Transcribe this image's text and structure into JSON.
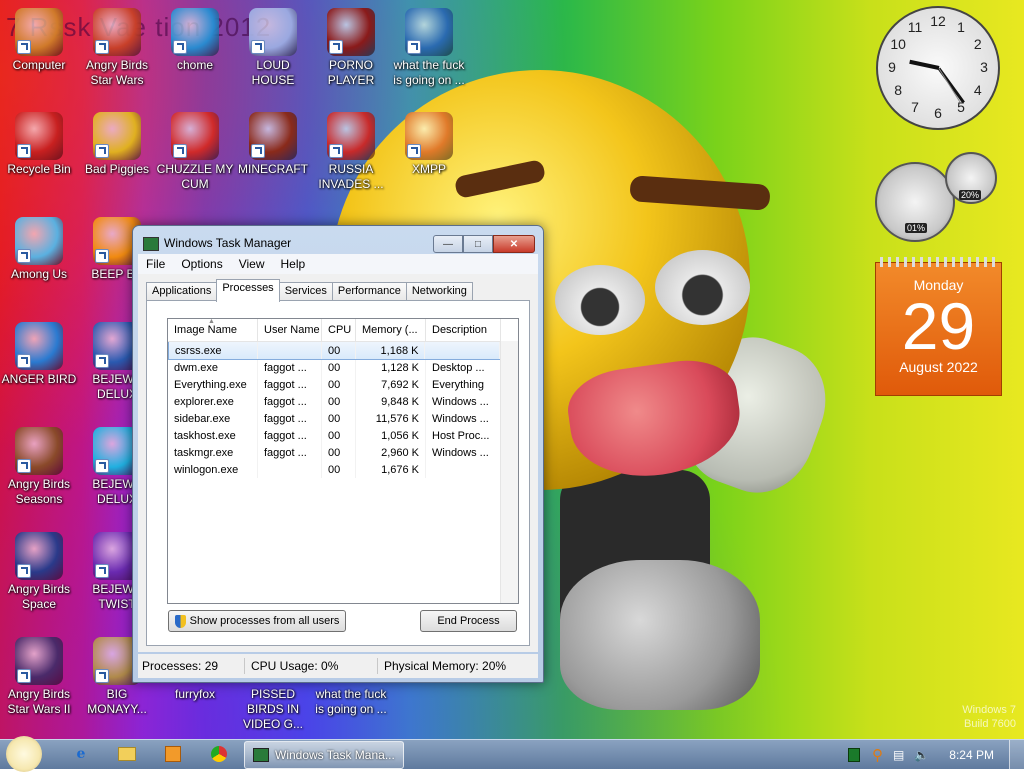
{
  "desktop": {
    "overlay_title": "7 Rssk Vae tion 2012",
    "icons": [
      {
        "label": "Computer",
        "icon": "computer-icon",
        "color": "#d07a2a"
      },
      {
        "label": "Angry Birds Star Wars",
        "icon": "angry-birds-star-wars-icon",
        "color": "#c8402a"
      },
      {
        "label": "chome",
        "icon": "chrome-icon",
        "color": "#2a8ad0"
      },
      {
        "label": "LOUD HOUSE",
        "icon": "loud-house-icon",
        "color": "#9aa8e0"
      },
      {
        "label": "PORNO PLAYER",
        "icon": "flash-player-icon",
        "color": "#8a1a1a"
      },
      {
        "label": "what the fuck is going on ...",
        "icon": "angry-birds-space-icon",
        "color": "#2a6ab0"
      },
      {
        "label": "Recycle Bin",
        "icon": "recycle-bin-icon",
        "color": "#c82020"
      },
      {
        "label": "Bad Piggies",
        "icon": "bad-piggies-icon",
        "color": "#e0b020"
      },
      {
        "label": "CHUZZLE MY CUM",
        "icon": "chuzzle-icon",
        "color": "#d02a2a"
      },
      {
        "label": "MINECRAFT",
        "icon": "minecraft-icon",
        "color": "#8a2a1a"
      },
      {
        "label": "RUSSIA INVADES ...",
        "icon": "radiation-icon",
        "color": "#c82a2a"
      },
      {
        "label": "XMPP",
        "icon": "xampp-icon",
        "color": "#e07a2a"
      },
      {
        "label": "Among Us",
        "icon": "among-us-icon",
        "color": "#5ab0e0"
      },
      {
        "label": "BEEP BE",
        "icon": "vlc-icon",
        "color": "#f08a10"
      },
      {
        "label": "ANGER BIRD",
        "icon": "angry-bird-icon",
        "color": "#2a7ad0"
      },
      {
        "label": "BEJEWE DELUX",
        "icon": "bejeweled-2-icon",
        "color": "#2a5ab0"
      },
      {
        "label": "Angry Birds Seasons",
        "icon": "angry-birds-seasons-icon",
        "color": "#8a4a2a"
      },
      {
        "label": "BEJEWE DELUX",
        "icon": "bejeweled-icon",
        "color": "#20b0e0"
      },
      {
        "label": "Angry Birds Space",
        "icon": "angry-birds-space-icon",
        "color": "#2a3a8a"
      },
      {
        "label": "BEJEWE TWIST",
        "icon": "bejeweled-twist-icon",
        "color": "#6a2ab0"
      },
      {
        "label": "Angry Birds Star Wars II",
        "icon": "angry-birds-star-wars-2-icon",
        "color": "#4a2a6a"
      },
      {
        "label": "BIG MONAYY...",
        "icon": "money-bag-icon",
        "color": "#b08a4a"
      },
      {
        "label": "furryfox",
        "icon": "furryfox-icon",
        "color": ""
      },
      {
        "label": "PISSED BIRDS IN VIDEO G...",
        "icon": "pissed-birds-icon",
        "color": ""
      },
      {
        "label": "what the fuck is going on ...",
        "icon": "what-icon",
        "color": ""
      }
    ]
  },
  "task_manager": {
    "title": "Windows Task Manager",
    "menu": [
      "File",
      "Options",
      "View",
      "Help"
    ],
    "tabs": [
      "Applications",
      "Processes",
      "Services",
      "Performance",
      "Networking"
    ],
    "active_tab": "Processes",
    "columns": [
      "Image Name",
      "User Name",
      "CPU",
      "Memory (...",
      "Description"
    ],
    "rows": [
      {
        "name": "csrss.exe",
        "user": "",
        "cpu": "00",
        "mem": "1,168 K",
        "desc": ""
      },
      {
        "name": "dwm.exe",
        "user": "faggot ...",
        "cpu": "00",
        "mem": "1,128 K",
        "desc": "Desktop ..."
      },
      {
        "name": "Everything.exe",
        "user": "faggot ...",
        "cpu": "00",
        "mem": "7,692 K",
        "desc": "Everything"
      },
      {
        "name": "explorer.exe",
        "user": "faggot ...",
        "cpu": "00",
        "mem": "9,848 K",
        "desc": "Windows ..."
      },
      {
        "name": "sidebar.exe",
        "user": "faggot ...",
        "cpu": "00",
        "mem": "11,576 K",
        "desc": "Windows ..."
      },
      {
        "name": "taskhost.exe",
        "user": "faggot ...",
        "cpu": "00",
        "mem": "1,056 K",
        "desc": "Host Proc..."
      },
      {
        "name": "taskmgr.exe",
        "user": "faggot ...",
        "cpu": "00",
        "mem": "2,960 K",
        "desc": "Windows ..."
      },
      {
        "name": "winlogon.exe",
        "user": "",
        "cpu": "00",
        "mem": "1,676 K",
        "desc": ""
      }
    ],
    "show_all_label": "Show processes from all users",
    "end_process_label": "End Process",
    "status": {
      "processes": "Processes: 29",
      "cpu": "CPU Usage: 0%",
      "memory": "Physical Memory: 20%"
    }
  },
  "gadgets": {
    "clock": {
      "numerals": [
        "12",
        "1",
        "2",
        "3",
        "4",
        "5",
        "6",
        "7",
        "8",
        "9",
        "10",
        "11"
      ]
    },
    "meters": {
      "cpu_label": "01%",
      "memory_label": "20%"
    },
    "calendar": {
      "day": "Monday",
      "date": "29",
      "month": "August 2022"
    }
  },
  "watermark": {
    "line1": "Windows 7",
    "line2": "Build 7600"
  },
  "taskbar": {
    "task_label": "Windows Task Mana...",
    "time": "8:24 PM"
  }
}
